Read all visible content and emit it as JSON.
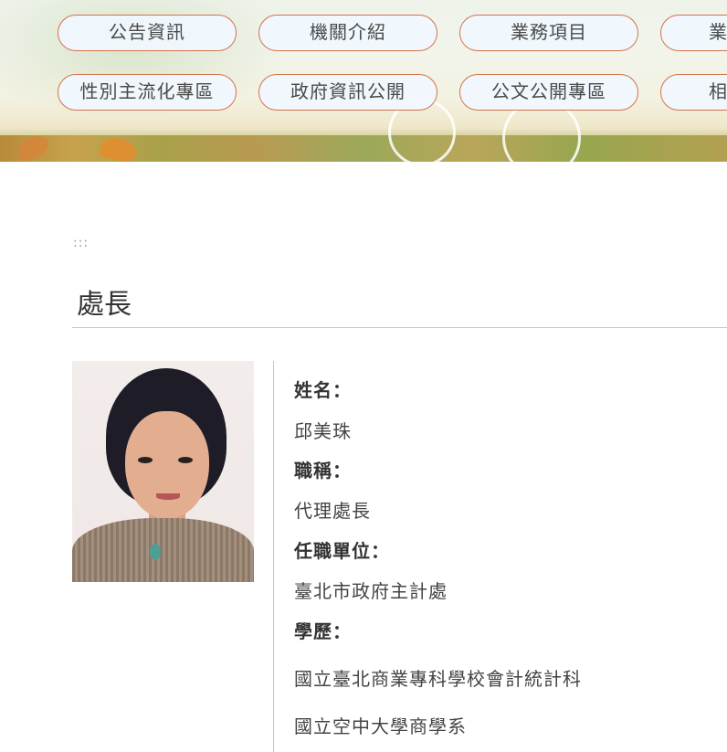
{
  "nav": {
    "row1": [
      "公告資訊",
      "機關介紹",
      "業務項目",
      "業"
    ],
    "row2": [
      "性別主流化專區",
      "政府資訊公開",
      "公文公開專區",
      "相"
    ]
  },
  "breadcrumb_marker": ":::",
  "page_title": "處長",
  "profile": {
    "name_label": "姓名：",
    "name": "邱美珠",
    "title_label": "職稱：",
    "title": "代理處長",
    "unit_label": "任職單位：",
    "unit": "臺北市政府主計處",
    "education_label": "學歷：",
    "education": [
      "國立臺北商業專科學校會計統計科",
      "國立空中大學商學系"
    ]
  }
}
